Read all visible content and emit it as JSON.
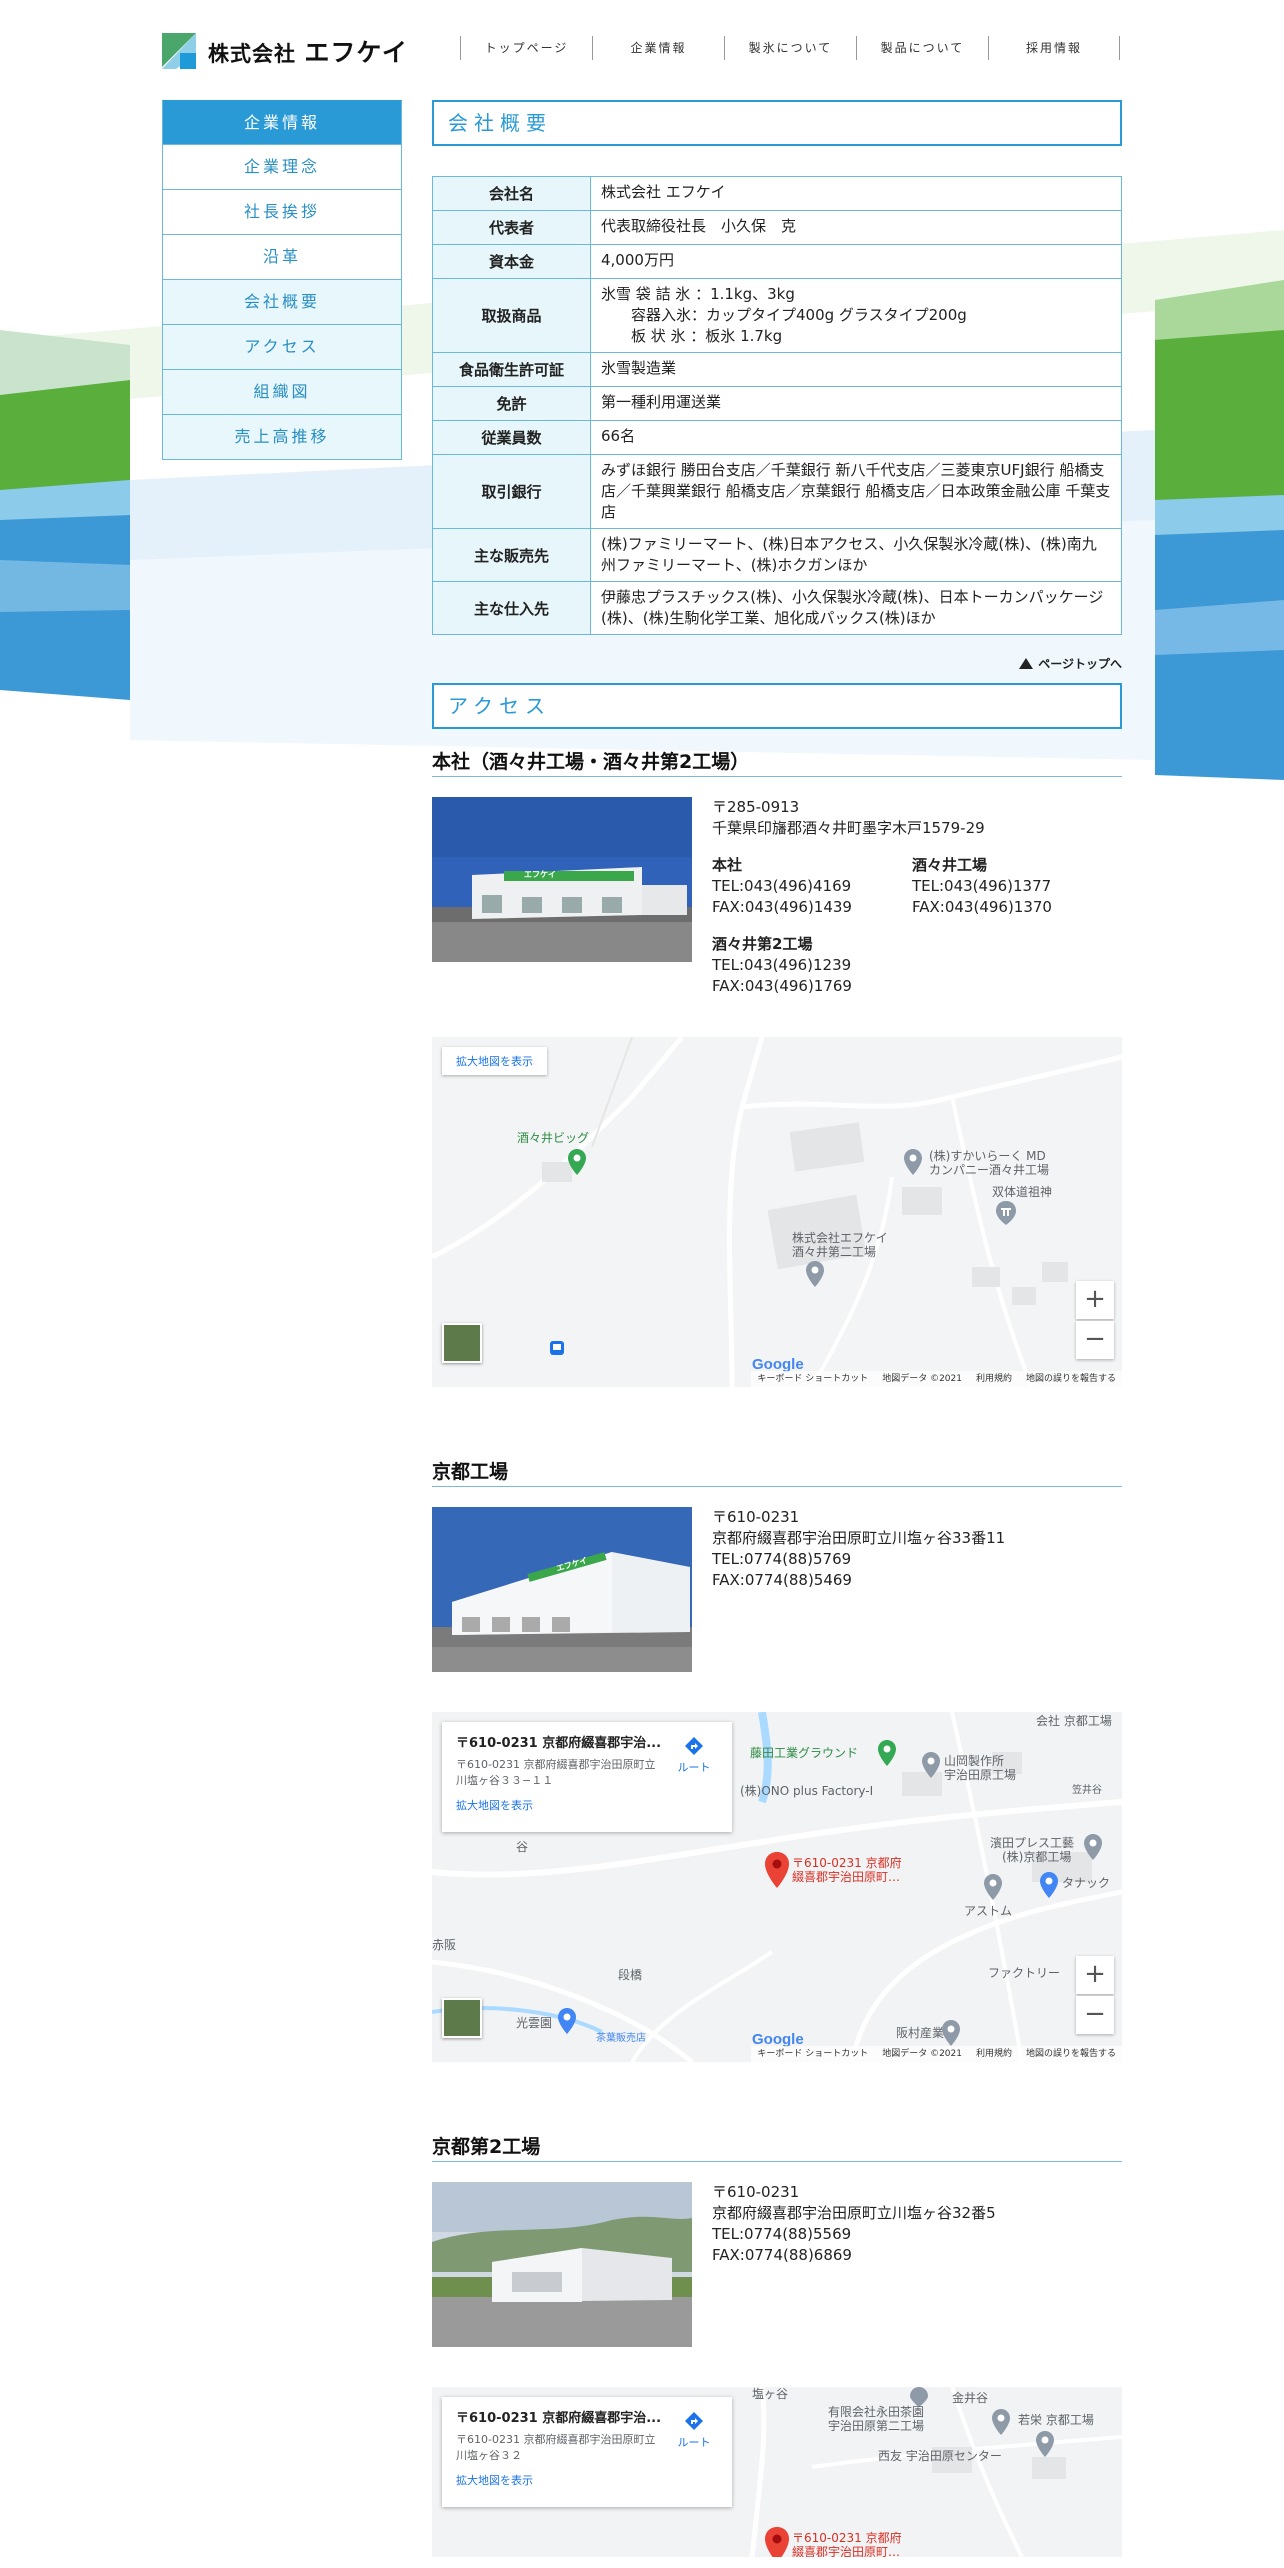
{
  "company": {
    "logo_small": "株式会社",
    "logo_big": "エフケイ"
  },
  "nav": [
    "トップページ",
    "企業情報",
    "製氷について",
    "製品について",
    "採用情報"
  ],
  "sidebar": [
    "企業情報",
    "企業理念",
    "社長挨拶",
    "沿革",
    "会社概要",
    "アクセス",
    "組織図",
    "売上高推移"
  ],
  "overview": {
    "heading": "会社概要",
    "rows": [
      {
        "th": "会社名",
        "td": "株式会社 エフケイ"
      },
      {
        "th": "代表者",
        "td": "代表取締役社長　小久保　克"
      },
      {
        "th": "資本金",
        "td": "4,000万円"
      },
      {
        "th": "取扱商品",
        "td": "氷雪 袋 詰 氷 ：1.1kg、3kg\n　　容器入氷：カップタイプ400g グラスタイプ200g\n　　板 状 氷 ：板氷 1.7kg"
      },
      {
        "th": "食品衛生許可証",
        "td": "氷雪製造業"
      },
      {
        "th": "免許",
        "td": "第一種利用運送業"
      },
      {
        "th": "従業員数",
        "td": "66名"
      },
      {
        "th": "取引銀行",
        "td": "みずほ銀行 勝田台支店／千葉銀行 新八千代支店／三菱東京UFJ銀行 船橋支店／千葉興業銀行 船橋支店／京葉銀行 船橋支店／日本政策金融公庫 千葉支店"
      },
      {
        "th": "主な販売先",
        "td": "(株)ファミリーマート、(株)日本アクセス、小久保製氷冷蔵(株)、(株)南九州ファミリーマート、(株)ホクガンほか"
      },
      {
        "th": "主な仕入先",
        "td": "伊藤忠プラスチックス(株)、小久保製氷冷蔵(株)、日本トーカンパッケージ(株)、(株)生駒化学工業、旭化成パックス(株)ほか"
      }
    ]
  },
  "pagetop": "ページトップへ",
  "access": {
    "heading": "アクセス",
    "hq": {
      "title": "本社（酒々井工場・酒々井第2工場）",
      "zip": "〒285-0913",
      "address": "千葉県印旛郡酒々井町墨字木戸1579-29",
      "contacts": [
        {
          "name": "本社",
          "tel": "TEL:043(496)4169",
          "fax": "FAX:043(496)1439"
        },
        {
          "name": "酒々井工場",
          "tel": "TEL:043(496)1377",
          "fax": "FAX:043(496)1370"
        },
        {
          "name": "酒々井第2工場",
          "tel": "TEL:043(496)1239",
          "fax": "FAX:043(496)1769"
        }
      ],
      "photo_sign": "エフケイ",
      "map": {
        "link": "拡大地図を表示",
        "labels": [
          "酒々井ビッグ",
          "(株)すかいらーく MD",
          "カンパニー酒々井工場",
          "双体道祖神",
          "株式会社エフケイ",
          "酒々井第二工場"
        ]
      }
    },
    "kyoto": {
      "title": "京都工場",
      "zip": "〒610-0231",
      "address": "京都府綴喜郡宇治田原町立川塩ヶ谷33番11",
      "tel": "TEL:0774(88)5769",
      "fax": "FAX:0774(88)5469",
      "photo_sign": "エフケイ",
      "map": {
        "info_title": "〒610-0231 京都府綴喜郡宇治...",
        "info_addr": "〒610-0231 京都府綴喜郡宇治田原町立川塩ヶ谷３３−１１",
        "info_link": "拡大地図を表示",
        "route": "ルート",
        "labels": [
          "藤田工業グラウンド",
          "(株)ONO plus Factory-I",
          "山岡製作所",
          "宇治田原工場",
          "会社 京都工場",
          "濱田プレス工藝",
          "(株)京都工場",
          "〒610-0231 京都府",
          "綴喜郡宇治田原町…",
          "タナック",
          "アストム",
          "ファクトリー",
          "光雲園",
          "茶葉販売店",
          "阪村産業",
          "段橋",
          "赤阪",
          "谷",
          "笠井谷"
        ]
      }
    },
    "kyoto2": {
      "title": "京都第2工場",
      "zip": "〒610-0231",
      "address": "京都府綴喜郡宇治田原町立川塩ヶ谷32番5",
      "tel": "TEL:0774(88)5569",
      "fax": "FAX:0774(88)6869",
      "map": {
        "info_title": "〒610-0231 京都府綴喜郡宇治...",
        "info_addr": "〒610-0231 京都府綴喜郡宇治田原町立川塩ヶ谷３２",
        "info_link": "拡大地図を表示",
        "route": "ルート",
        "labels": [
          "塩ヶ谷",
          "金井谷",
          "有限会社永田茶園",
          "宇治田原第二工場",
          "若栄 京都工場",
          "西友 宇治田原センター",
          "〒610-0231 京都府",
          "綴喜郡宇治田原町…"
        ]
      }
    },
    "map_common": {
      "google": "Google",
      "shortcuts": "キーボード ショートカット",
      "mapdata": "地図データ ©2021",
      "terms": "利用規約",
      "report": "地図の誤りを報告する",
      "zoom_in": "+",
      "zoom_out": "−"
    }
  },
  "colors": {
    "accent": "#2a9ad6",
    "pale": "#e6f6fb",
    "green": "#5aae3c"
  }
}
